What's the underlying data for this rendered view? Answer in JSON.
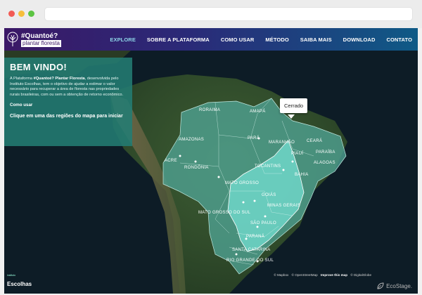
{
  "logo": {
    "line1": "#Quantoé?",
    "line2": "plantar floresta"
  },
  "nav": [
    {
      "label": "EXPLORE",
      "active": true
    },
    {
      "label": "SOBRE A PLATAFORMA"
    },
    {
      "label": "COMO USAR"
    },
    {
      "label": "MÉTODO"
    },
    {
      "label": "SAIBA MAIS"
    },
    {
      "label": "DOWNLOAD"
    },
    {
      "label": "CONTATO"
    }
  ],
  "panel": {
    "title": "BEM VINDO!",
    "body_prefix": "A Plataforma ",
    "body_bold": "#Quantoé? Plantar Floresta",
    "body_suffix": ", desenvolvida pelo Instituto Escolhas, tem o objetivo de ajudar a estimar o valor necessário para recuperar a área de floresta nas propriedades rurais brasileiras, com ou sem a obtenção de retorno econômico.",
    "link": "Como usar",
    "cta": "Clique em uma das regiões do mapa para iniciar"
  },
  "tooltip": "Cerrado",
  "states": [
    "RORAIMA",
    "AMAPÁ",
    "AMAZONAS",
    "PARÁ",
    "MARANHÃO",
    "CEARÁ",
    "PIAUÍ",
    "PARAÍBA",
    "ALAGOAS",
    "ACRE",
    "RONDÔNIA",
    "TOCANTINS",
    "BAHIA",
    "MATO GROSSO",
    "GOIÁS",
    "MINAS GERAIS",
    "MATO GROSSO DO SUL",
    "SÃO PAULO",
    "PARANÁ",
    "SANTA CATARINA",
    "RIO GRANDE DO SUL"
  ],
  "attribution": {
    "mapbox": "© Mapbox",
    "osm": "© OpenStreetMap",
    "improve": "Improve this map",
    "digitalglobe": "© DigitalGlobe"
  },
  "footer": {
    "partner_small": "instituto",
    "partner_big": "Escolhas",
    "credit": "EcoStage."
  },
  "colors": {
    "amazon": "#4fa393",
    "cerrado": "#6fd6c8",
    "panel": "#237c73",
    "nav_active": "#8fd6e8"
  }
}
